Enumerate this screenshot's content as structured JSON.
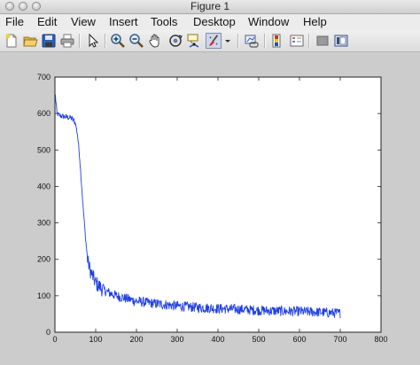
{
  "window": {
    "title": "Figure 1"
  },
  "menu": {
    "items": [
      {
        "label": "File",
        "name": "menu-file"
      },
      {
        "label": "Edit",
        "name": "menu-edit"
      },
      {
        "label": "View",
        "name": "menu-view"
      },
      {
        "label": "Insert",
        "name": "menu-insert"
      },
      {
        "label": "Tools",
        "name": "menu-tools"
      },
      {
        "label": "Desktop",
        "name": "menu-desktop"
      },
      {
        "label": "Window",
        "name": "menu-window"
      },
      {
        "label": "Help",
        "name": "menu-help"
      }
    ]
  },
  "toolbar": {
    "icons": [
      "new-figure-icon",
      "open-file-icon",
      "save-icon",
      "print-icon",
      "edit-plot-icon",
      "zoom-in-icon",
      "zoom-out-icon",
      "pan-icon",
      "rotate-3d-icon",
      "data-cursor-icon",
      "brush-icon",
      "brush-dropdown-icon",
      "link-plot-icon",
      "insert-colorbar-icon",
      "insert-legend-icon",
      "hide-plot-tools-icon",
      "show-plot-tools-icon"
    ]
  },
  "chart_data": {
    "type": "line",
    "series_color": "#1f3fe0",
    "xlim": [
      0,
      800
    ],
    "ylim": [
      0,
      700
    ],
    "x_ticks": [
      0,
      100,
      200,
      300,
      400,
      500,
      600,
      700,
      800
    ],
    "y_ticks": [
      0,
      100,
      200,
      300,
      400,
      500,
      600,
      700
    ],
    "x_tick_labels": [
      "0",
      "100",
      "200",
      "300",
      "400",
      "500",
      "600",
      "700",
      "800"
    ],
    "y_tick_labels": [
      "0",
      "100",
      "200",
      "300",
      "400",
      "500",
      "600",
      "700"
    ],
    "grid": false,
    "series": [
      {
        "x": [
          1,
          5,
          10,
          20,
          30,
          40,
          50,
          55,
          60,
          65,
          70,
          75,
          80,
          85,
          90,
          100,
          120,
          150,
          200,
          250,
          300,
          350,
          400,
          450,
          500,
          550,
          600,
          650,
          700
        ],
        "y": [
          650,
          600,
          595,
          592,
          590,
          588,
          575,
          545,
          490,
          410,
          330,
          260,
          200,
          175,
          160,
          135,
          115,
          100,
          85,
          78,
          72,
          68,
          65,
          63,
          60,
          58,
          57,
          55,
          52
        ]
      }
    ]
  }
}
